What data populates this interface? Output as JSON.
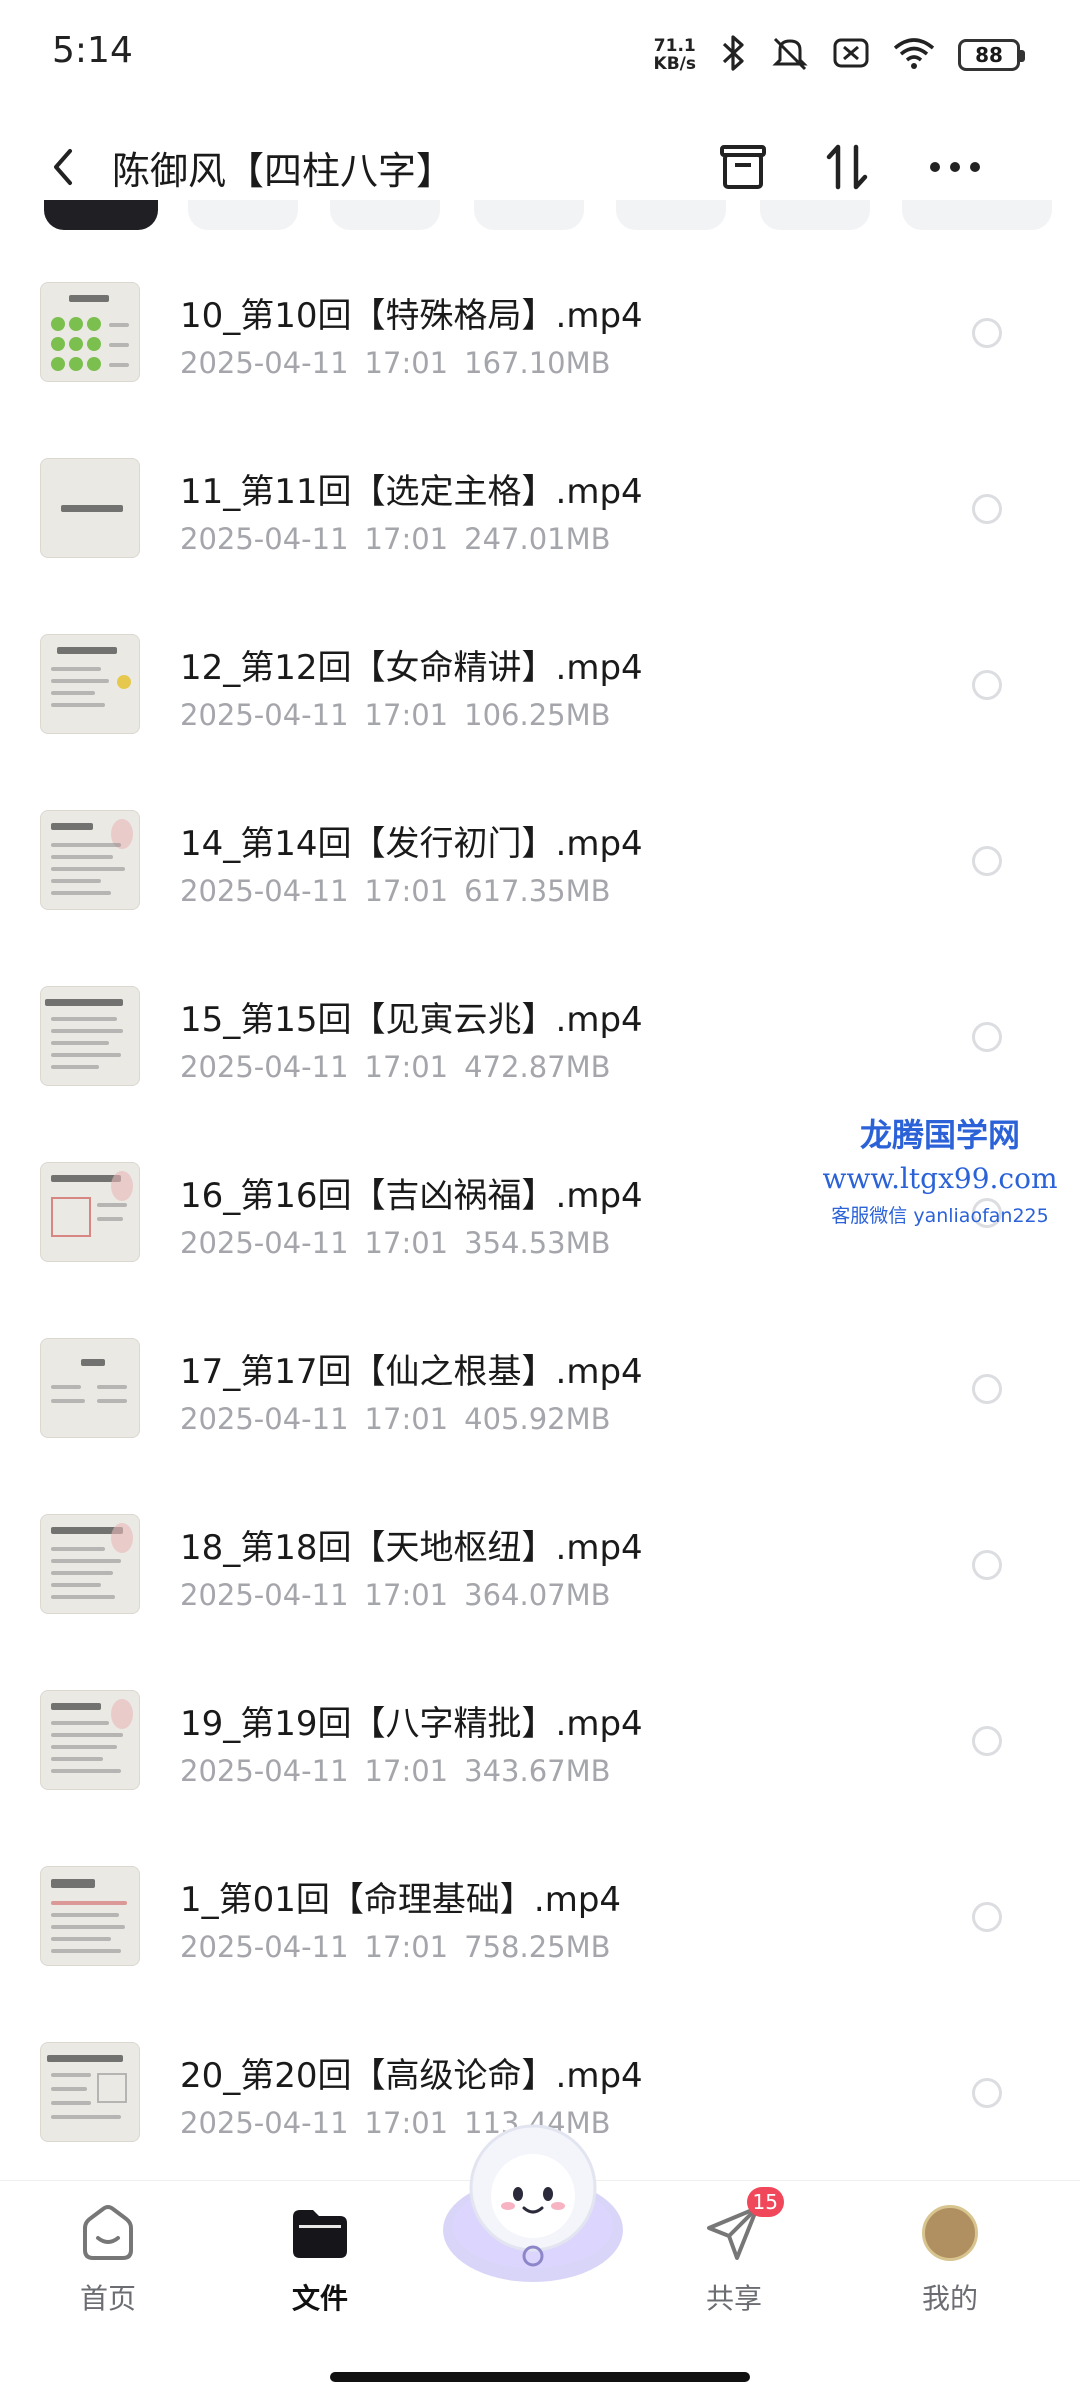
{
  "status_bar": {
    "time": "5:14",
    "net_speed_value": "71.1",
    "net_speed_unit": "KB/s",
    "battery": "88"
  },
  "header": {
    "title": "陈御风【四柱八字】"
  },
  "files": [
    {
      "name": "10_第10回【特殊格局】.mp4",
      "date": "2025-04-11",
      "time": "17:01",
      "size": "167.10MB"
    },
    {
      "name": "11_第11回【选定主格】.mp4",
      "date": "2025-04-11",
      "time": "17:01",
      "size": "247.01MB"
    },
    {
      "name": "12_第12回【女命精讲】.mp4",
      "date": "2025-04-11",
      "time": "17:01",
      "size": "106.25MB"
    },
    {
      "name": "14_第14回【发行初门】.mp4",
      "date": "2025-04-11",
      "time": "17:01",
      "size": "617.35MB"
    },
    {
      "name": "15_第15回【见寅云兆】.mp4",
      "date": "2025-04-11",
      "time": "17:01",
      "size": "472.87MB"
    },
    {
      "name": "16_第16回【吉凶祸福】.mp4",
      "date": "2025-04-11",
      "time": "17:01",
      "size": "354.53MB"
    },
    {
      "name": "17_第17回【仙之根基】.mp4",
      "date": "2025-04-11",
      "time": "17:01",
      "size": "405.92MB"
    },
    {
      "name": "18_第18回【天地枢纽】.mp4",
      "date": "2025-04-11",
      "time": "17:01",
      "size": "364.07MB"
    },
    {
      "name": "19_第19回【八字精批】.mp4",
      "date": "2025-04-11",
      "time": "17:01",
      "size": "343.67MB"
    },
    {
      "name": "1_第01回【命理基础】.mp4",
      "date": "2025-04-11",
      "time": "17:01",
      "size": "758.25MB"
    },
    {
      "name": "20_第20回【高级论命】.mp4",
      "date": "2025-04-11",
      "time": "17:01",
      "size": "113.44MB"
    }
  ],
  "watermark": {
    "line1": "龙腾国学网",
    "line2": "www.ltgx99.com",
    "line3": "客服微信 yanliaofan225"
  },
  "bottom_nav": {
    "items": [
      {
        "label": "首页",
        "icon": "home-icon"
      },
      {
        "label": "文件",
        "icon": "folder-icon"
      },
      {
        "label": "共享",
        "icon": "share-plane-icon",
        "badge": "15"
      },
      {
        "label": "我的",
        "icon": "avatar"
      }
    ]
  },
  "colors": {
    "accent_dark": "#1f1f24",
    "meta_gray": "#a4a6ab",
    "badge_red": "#f0485a",
    "watermark_blue": "#2b62d8"
  }
}
